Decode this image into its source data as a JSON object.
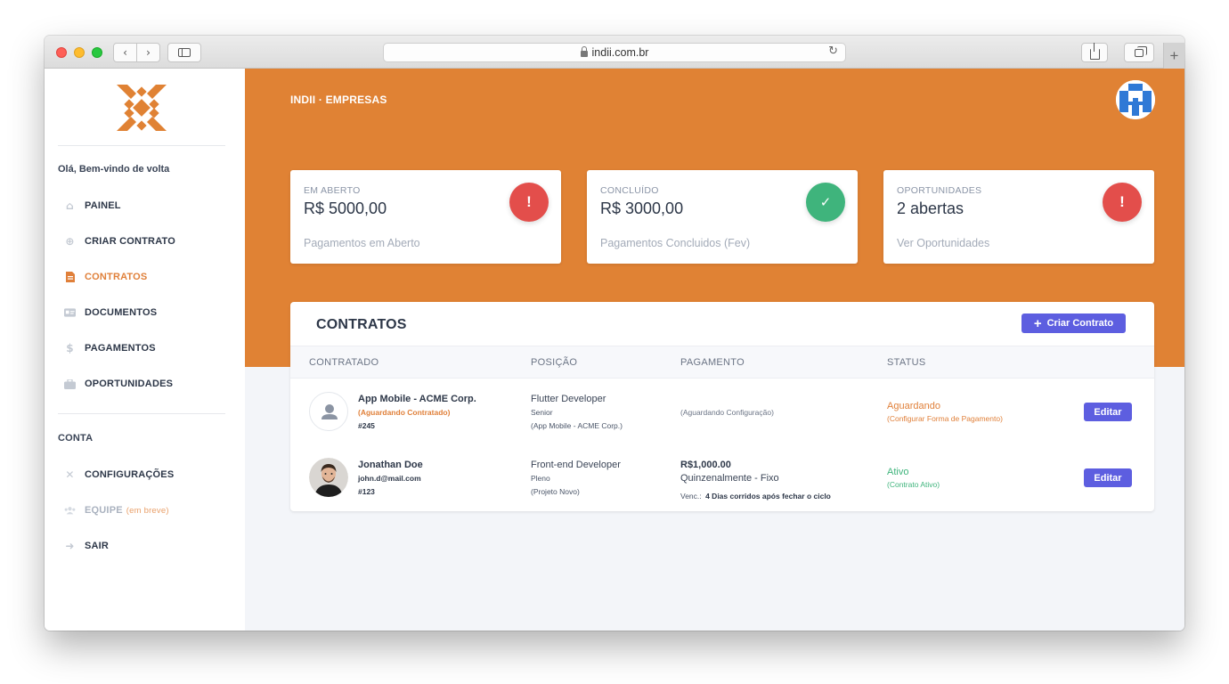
{
  "browser": {
    "url": "indii.com.br"
  },
  "sidebar": {
    "welcome": "Olá, Bem-vindo de volta",
    "items": [
      {
        "label": "PAINEL",
        "icon": "home-icon"
      },
      {
        "label": "CRIAR CONTRATO",
        "icon": "plus-circle-icon"
      },
      {
        "label": "CONTRATOS",
        "icon": "document-icon",
        "active": true
      },
      {
        "label": "DOCUMENTOS",
        "icon": "id-card-icon"
      },
      {
        "label": "PAGAMENTOS",
        "icon": "dollar-icon"
      },
      {
        "label": "OPORTUNIDADES",
        "icon": "briefcase-icon"
      }
    ],
    "account_label": "CONTA",
    "account_items": [
      {
        "label": "CONFIGURAÇÕES",
        "icon": "tools-icon"
      },
      {
        "label": "EQUIPE",
        "suffix": "(em breve)",
        "icon": "users-icon",
        "disabled": true
      },
      {
        "label": "SAIR",
        "icon": "sign-out-icon"
      }
    ]
  },
  "header": {
    "brand": "INDII · EMPRESAS"
  },
  "stats": [
    {
      "label": "EM ABERTO",
      "value": "R$ 5000,00",
      "sub": "Pagamentos em Aberto",
      "badge": "!",
      "badge_color": "#e34e4b"
    },
    {
      "label": "CONCLUÍDO",
      "value": "R$ 3000,00",
      "sub": "Pagamentos Concluidos (Fev)",
      "badge": "✓",
      "badge_color": "#3fb47c"
    },
    {
      "label": "OPORTUNIDADES",
      "value": "2 abertas",
      "sub": "Ver Oportunidades",
      "badge": "!",
      "badge_color": "#e34e4b"
    }
  ],
  "contracts": {
    "title": "CONTRATOS",
    "create_label": "Criar Contrato",
    "create_icon": "+",
    "columns": [
      "CONTRATADO",
      "POSIÇÃO",
      "PAGAMENTO",
      "STATUS"
    ],
    "rows": [
      {
        "name": "App Mobile - ACME Corp.",
        "sub": "(Aguardando Contratado)",
        "id": "#245",
        "position": "Flutter Developer",
        "level": "Senior",
        "project": "(App Mobile - ACME Corp.)",
        "payment": "(Aguardando Configuração)",
        "status": "Aguardando",
        "status_sub": "(Configurar Forma de Pagamento)",
        "action": "Editar"
      },
      {
        "name": "Jonathan Doe",
        "sub": "john.d@mail.com",
        "id": "#123",
        "position": "Front-end Developer",
        "level": "Pleno",
        "project": "(Projeto Novo)",
        "payment_amount": "R$1,000.00",
        "payment_type": "Quinzenalmente - Fixo",
        "payment_due_label": "Venc.:",
        "payment_due": "4 Dias corridos após fechar o ciclo",
        "status": "Ativo",
        "status_sub": "(Contrato Ativo)",
        "action": "Editar"
      }
    ]
  },
  "colors": {
    "accent": "#e08234",
    "primary": "#5d5ee0",
    "danger": "#e34e4b",
    "success": "#3fb47c"
  }
}
